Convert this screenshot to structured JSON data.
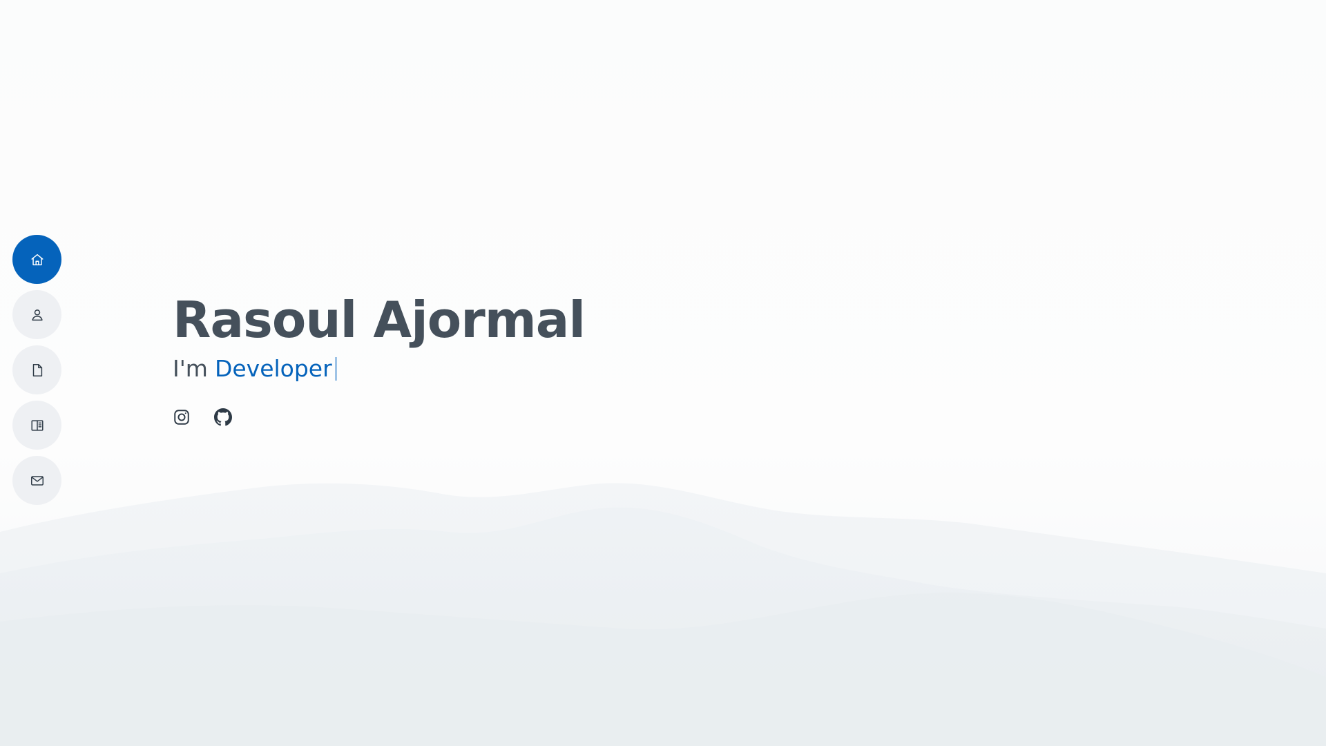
{
  "hero": {
    "name": "Rasoul Ajormal",
    "tagline_prefix": "I'm",
    "tagline_role": "Developer"
  },
  "nav": {
    "items": [
      {
        "id": "home",
        "icon": "home-icon",
        "active": true
      },
      {
        "id": "about",
        "icon": "person-icon",
        "active": false
      },
      {
        "id": "resume",
        "icon": "file-icon",
        "active": false
      },
      {
        "id": "portfolio",
        "icon": "book-half-icon",
        "active": false
      },
      {
        "id": "contact",
        "icon": "envelope-icon",
        "active": false
      }
    ]
  },
  "social": [
    {
      "id": "instagram",
      "icon": "instagram-icon"
    },
    {
      "id": "github",
      "icon": "github-icon"
    }
  ],
  "colors": {
    "accent": "#0563bb",
    "text": "#45505b",
    "nav_inactive_bg": "#eef0f3"
  }
}
